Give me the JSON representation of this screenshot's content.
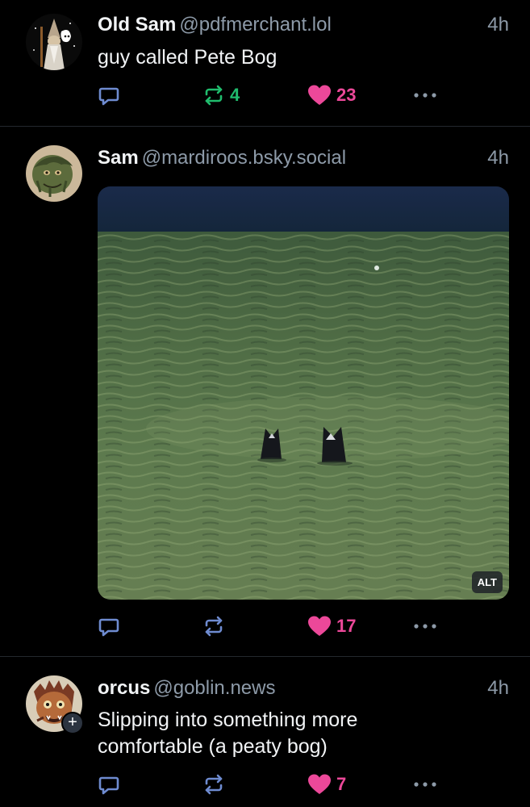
{
  "posts": [
    {
      "name": "Old Sam",
      "handle": "@pdfmerchant.lol",
      "time": "4h",
      "text": "guy called Pete Bog",
      "reposts": "4",
      "likes": "23",
      "repost_active": true,
      "like_active": true,
      "avatar": "wizard-avatar"
    },
    {
      "name": "Sam",
      "handle": "@mardiroos.bsky.social",
      "time": "4h",
      "image_alt_label": "ALT",
      "reposts": "",
      "likes": "17",
      "repost_active": false,
      "like_active": true,
      "avatar": "swamp-creature-avatar"
    },
    {
      "name": "orcus",
      "handle": "@goblin.news",
      "time": "4h",
      "text": "Slipping into something more comfortable (a peaty bog)",
      "reposts": "",
      "likes": "7",
      "repost_active": false,
      "like_active": true,
      "avatar": "demon-mask-avatar",
      "follow_symbol": "+"
    }
  ],
  "colors": {
    "background": "#000000",
    "muted": "#8d9aa8",
    "icon": "#6e8bd0",
    "repost_active": "#20bc6d",
    "like": "#ec4899",
    "divider": "#24282e"
  }
}
